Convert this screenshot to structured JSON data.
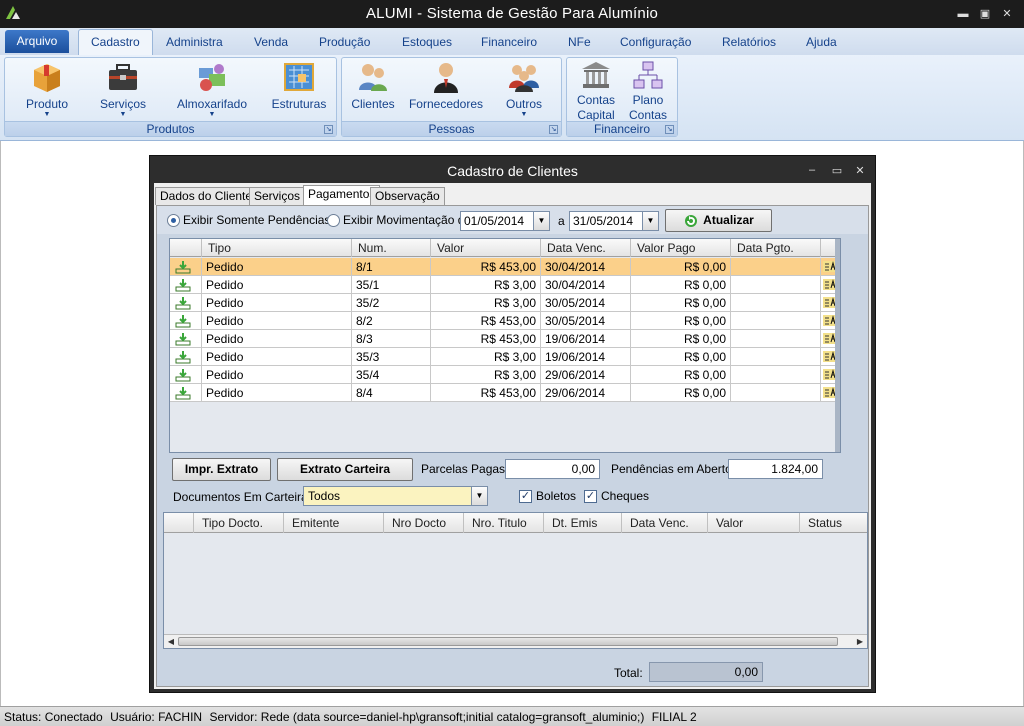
{
  "window": {
    "title": "ALUMI - Sistema de Gestão Para Alumínio",
    "minimize": "▬",
    "restore": "▣",
    "close": "✕"
  },
  "menu": {
    "arquivo": "Arquivo",
    "tabs": [
      "Cadastro",
      "Administra",
      "Venda",
      "Produção",
      "Estoques",
      "Financeiro",
      "NFe",
      "Configuração",
      "Relatórios",
      "Ajuda"
    ],
    "active_tab": "Cadastro"
  },
  "ribbon": {
    "groups": {
      "produtos": {
        "label": "Produtos",
        "buttons": [
          {
            "label": "Produto",
            "icon": "box-icon"
          },
          {
            "label": "Serviços",
            "icon": "toolbox-icon"
          },
          {
            "label": "Almoxarifado",
            "icon": "parts-icon"
          },
          {
            "label": "Estruturas",
            "icon": "blueprint-icon"
          }
        ]
      },
      "pessoas": {
        "label": "Pessoas",
        "buttons": [
          {
            "label": "Clientes",
            "icon": "users-icon"
          },
          {
            "label": "Fornecedores",
            "icon": "supplier-icon"
          },
          {
            "label": "Outros",
            "icon": "group-icon"
          }
        ]
      },
      "financeiro": {
        "label": "Financeiro",
        "buttons": [
          {
            "label1": "Contas",
            "label2": "Capital",
            "icon": "bank-icon"
          },
          {
            "label1": "Plano",
            "label2": "Contas",
            "icon": "org-chart-icon"
          }
        ]
      }
    }
  },
  "child_window": {
    "title": "Cadastro de Clientes",
    "minimize": "–",
    "maximize": "▭",
    "close": "✕",
    "tabs": [
      "Dados do Cliente",
      "Serviços",
      "Pagamentos",
      "Observação"
    ],
    "active_tab": "Pagamentos",
    "filter": {
      "radio_pending": "Exibir Somente Pendências",
      "radio_movement": "Exibir Movimentação de:",
      "selected": "radio_pending",
      "date_from": "01/05/2014",
      "date_sep": "a",
      "date_to": "31/05/2014",
      "refresh_button": "Atualizar"
    },
    "payments_grid": {
      "columns": [
        "Tipo",
        "Num.",
        "Valor",
        "Data Venc.",
        "Valor Pago",
        "Data Pgto."
      ],
      "rows": [
        {
          "tipo": "Pedido",
          "num": "8/1",
          "valor": "R$ 453,00",
          "venc": "30/04/2014",
          "pago": "R$ 0,00",
          "pgto": ""
        },
        {
          "tipo": "Pedido",
          "num": "35/1",
          "valor": "R$ 3,00",
          "venc": "30/04/2014",
          "pago": "R$ 0,00",
          "pgto": ""
        },
        {
          "tipo": "Pedido",
          "num": "35/2",
          "valor": "R$ 3,00",
          "venc": "30/05/2014",
          "pago": "R$ 0,00",
          "pgto": ""
        },
        {
          "tipo": "Pedido",
          "num": "8/2",
          "valor": "R$ 453,00",
          "venc": "30/05/2014",
          "pago": "R$ 0,00",
          "pgto": ""
        },
        {
          "tipo": "Pedido",
          "num": "8/3",
          "valor": "R$ 453,00",
          "venc": "19/06/2014",
          "pago": "R$ 0,00",
          "pgto": ""
        },
        {
          "tipo": "Pedido",
          "num": "35/3",
          "valor": "R$ 3,00",
          "venc": "19/06/2014",
          "pago": "R$ 0,00",
          "pgto": ""
        },
        {
          "tipo": "Pedido",
          "num": "35/4",
          "valor": "R$ 3,00",
          "venc": "29/06/2014",
          "pago": "R$ 0,00",
          "pgto": ""
        },
        {
          "tipo": "Pedido",
          "num": "8/4",
          "valor": "R$ 453,00",
          "venc": "29/06/2014",
          "pago": "R$ 0,00",
          "pgto": ""
        }
      ],
      "selected_row": 0,
      "selected_color": "#fbd08a"
    },
    "summary": {
      "print_statement": "Impr. Extrato",
      "wallet_statement": "Extrato Carteira",
      "paid_label": "Parcelas Pagas:",
      "paid_value": "0,00",
      "open_label": "Pendências em Aberto:",
      "open_value": "1.824,00"
    },
    "wallet": {
      "label": "Documentos Em Carteira:",
      "selected": "Todos",
      "boletos_label": "Boletos",
      "boletos_checked": true,
      "cheques_label": "Cheques",
      "cheques_checked": true,
      "columns": [
        "Tipo Docto.",
        "Emitente",
        "Nro Docto",
        "Nro. Titulo",
        "Dt. Emis",
        "Data Venc.",
        "Valor",
        "Status"
      ]
    },
    "total": {
      "label": "Total:",
      "value": "0,00"
    }
  },
  "status": {
    "connection": "Status: Conectado",
    "user": "Usuário: FACHIN",
    "server": "Servidor: Rede (data source=daniel-hp\\gransoft;initial catalog=gransoft_aluminio;)",
    "branch": "FILIAL 2"
  }
}
